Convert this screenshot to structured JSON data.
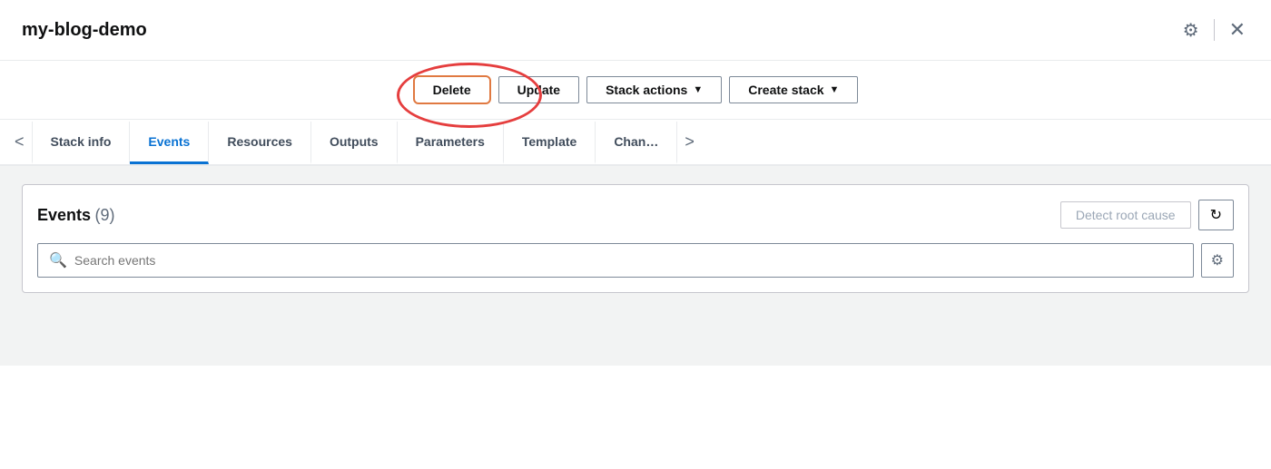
{
  "header": {
    "title": "my-blog-demo"
  },
  "toolbar": {
    "delete_label": "Delete",
    "update_label": "Update",
    "stack_actions_label": "Stack actions",
    "create_stack_label": "Create stack"
  },
  "tabs": {
    "scroll_left": "<",
    "scroll_right": ">",
    "items": [
      {
        "id": "stack-info",
        "label": "Stack info",
        "active": false
      },
      {
        "id": "events",
        "label": "Events",
        "active": true
      },
      {
        "id": "resources",
        "label": "Resources",
        "active": false
      },
      {
        "id": "outputs",
        "label": "Outputs",
        "active": false
      },
      {
        "id": "parameters",
        "label": "Parameters",
        "active": false
      },
      {
        "id": "template",
        "label": "Template",
        "active": false
      },
      {
        "id": "change-sets",
        "label": "Chan…",
        "active": false
      }
    ]
  },
  "events_panel": {
    "title": "Events",
    "count": "(9)",
    "detect_root_cause_label": "Detect root cause",
    "refresh_icon": "↻",
    "search_placeholder": "Search events",
    "settings_icon": "⚙"
  },
  "icons": {
    "gear": "⚙",
    "close": "✕",
    "search": "🔍",
    "caret_down": "▼"
  }
}
